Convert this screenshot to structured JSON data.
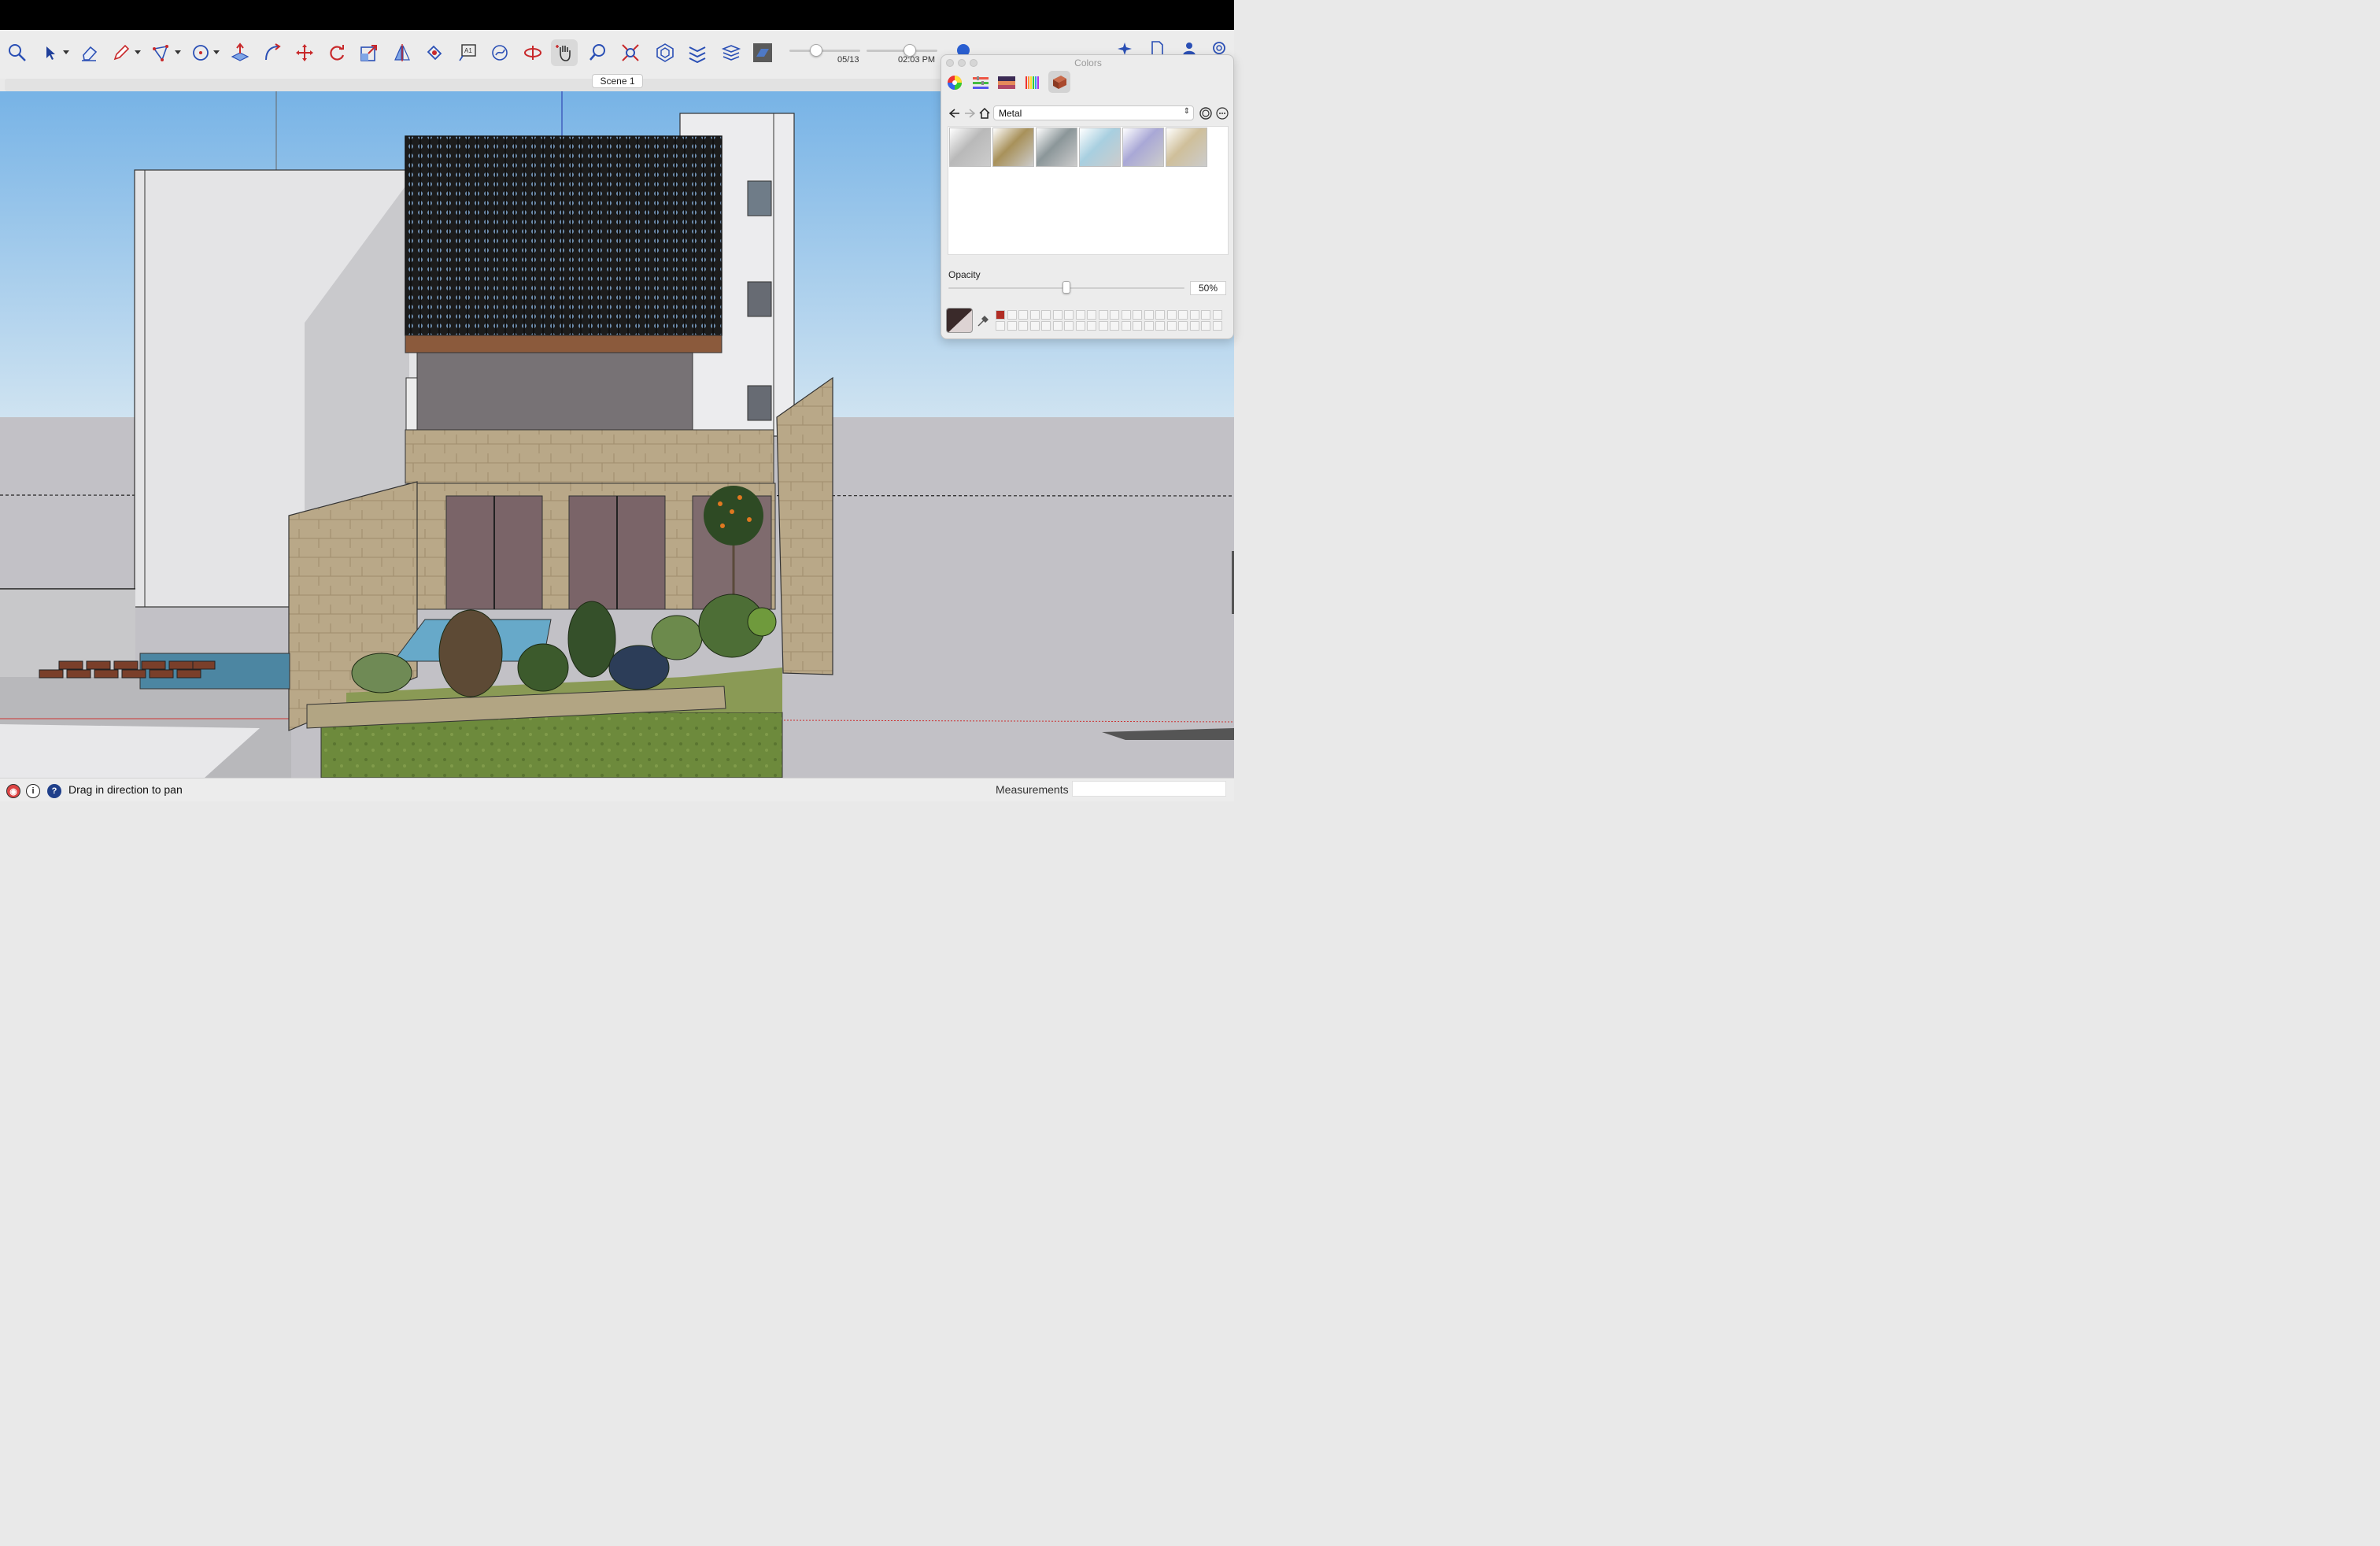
{
  "toolbar": {
    "tools": [
      "search",
      "select",
      "eraser",
      "pencil-line",
      "polygon",
      "circle",
      "push-pull",
      "follow-me",
      "move",
      "rotate",
      "scale",
      "flip",
      "paint-bucket",
      "text",
      "offset",
      "section-plane",
      "orbit",
      "pan",
      "zoom",
      "zoom-extents",
      "components",
      "tags",
      "layers",
      "styles"
    ],
    "active_tool": "pan",
    "date_label": "05/13",
    "time_label": "02:03 PM",
    "scene_tab": "Scene 1"
  },
  "colors_panel": {
    "title": "Colors",
    "tabs": [
      "color-wheel",
      "sliders",
      "image",
      "pencils",
      "materials"
    ],
    "selected_tab": "materials",
    "collection": "Metal",
    "materials": [
      {
        "name": "metal-silver",
        "color": "#b9b9b9"
      },
      {
        "name": "metal-gold",
        "color": "#a8915a"
      },
      {
        "name": "metal-steel",
        "color": "#8b9699"
      },
      {
        "name": "metal-corrugated-blue",
        "color": "#a8cfe0"
      },
      {
        "name": "metal-lavender-grid",
        "color": "#a9a8d6"
      },
      {
        "name": "metal-pale-gold",
        "color": "#cfbf9a"
      }
    ],
    "opacity_label": "Opacity",
    "opacity_value": "50%",
    "opacity_fraction": 0.5,
    "current_color": "#3a2a2a",
    "palette_first": "#b12d24"
  },
  "status": {
    "hint": "Drag in direction to pan",
    "measurements_label": "Measurements",
    "measurements_value": ""
  }
}
